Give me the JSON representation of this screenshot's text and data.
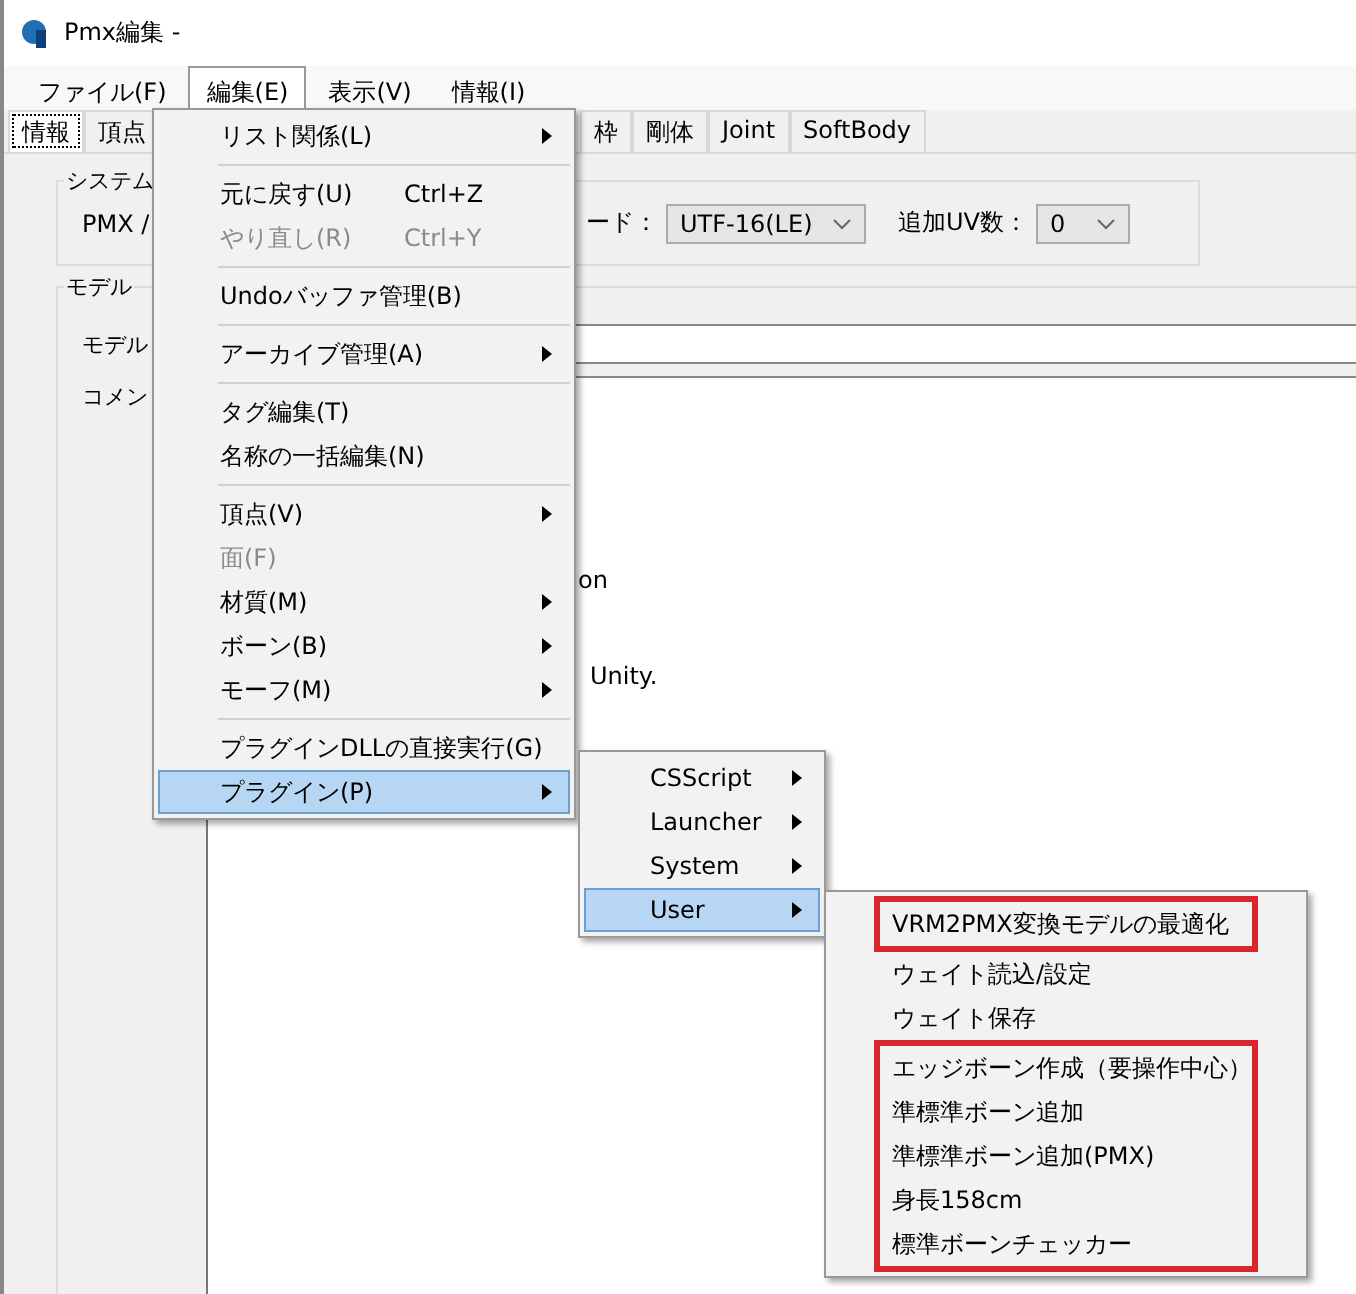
{
  "window": {
    "title": "Pmx編集 -"
  },
  "menubar": [
    {
      "label": "ファイル(F)",
      "selected": false
    },
    {
      "label": "編集(E)",
      "selected": true
    },
    {
      "label": "表示(V)",
      "selected": false
    },
    {
      "label": "情報(I)",
      "selected": false
    }
  ],
  "tabs_left": [
    {
      "label": "情報",
      "selected": true
    },
    {
      "label": "頂点",
      "selected": false
    }
  ],
  "tabs_right": [
    {
      "label": "枠",
      "selected": false
    },
    {
      "label": "剛体",
      "selected": false
    },
    {
      "label": "Joint",
      "selected": false
    },
    {
      "label": "SoftBody",
      "selected": false
    }
  ],
  "system_group": {
    "legend": "システム",
    "pmx_label": "PMX /",
    "encoding_label": "ード：",
    "encoding_value": "UTF-16(LE)",
    "uv_label": "追加UV数：",
    "uv_value": "0"
  },
  "model_group": {
    "legend": "モデル",
    "name_label": "モデル",
    "comment_label": "コメン",
    "comment_fragments": [
      "on",
      "Unity."
    ]
  },
  "edit_menu": [
    {
      "kind": "item",
      "label": "リスト関係(L)",
      "submenu": true,
      "disabled": false,
      "selected": false
    },
    {
      "kind": "separator"
    },
    {
      "kind": "item",
      "label": "元に戻す(U)",
      "shortcut": "Ctrl+Z",
      "submenu": false,
      "disabled": false,
      "selected": false
    },
    {
      "kind": "item",
      "label": "やり直し(R)",
      "shortcut": "Ctrl+Y",
      "submenu": false,
      "disabled": true,
      "selected": false
    },
    {
      "kind": "separator"
    },
    {
      "kind": "item",
      "label": "Undoバッファ管理(B)",
      "submenu": false,
      "disabled": false,
      "selected": false
    },
    {
      "kind": "separator"
    },
    {
      "kind": "item",
      "label": "アーカイブ管理(A)",
      "submenu": true,
      "disabled": false,
      "selected": false
    },
    {
      "kind": "separator"
    },
    {
      "kind": "item",
      "label": "タグ編集(T)",
      "submenu": false,
      "disabled": false,
      "selected": false
    },
    {
      "kind": "item",
      "label": "名称の一括編集(N)",
      "submenu": false,
      "disabled": false,
      "selected": false
    },
    {
      "kind": "separator"
    },
    {
      "kind": "item",
      "label": "頂点(V)",
      "submenu": true,
      "disabled": false,
      "selected": false
    },
    {
      "kind": "item",
      "label": "面(F)",
      "submenu": false,
      "disabled": true,
      "selected": false
    },
    {
      "kind": "item",
      "label": "材質(M)",
      "submenu": true,
      "disabled": false,
      "selected": false
    },
    {
      "kind": "item",
      "label": "ボーン(B)",
      "submenu": true,
      "disabled": false,
      "selected": false
    },
    {
      "kind": "item",
      "label": "モーフ(M)",
      "submenu": true,
      "disabled": false,
      "selected": false
    },
    {
      "kind": "separator"
    },
    {
      "kind": "item",
      "label": "プラグインDLLの直接実行(G)",
      "submenu": false,
      "disabled": false,
      "selected": false
    },
    {
      "kind": "item",
      "label": "プラグイン(P)",
      "submenu": true,
      "disabled": false,
      "selected": true
    }
  ],
  "plugin_menu": [
    {
      "label": "CSScript",
      "selected": false
    },
    {
      "label": "Launcher",
      "selected": false
    },
    {
      "label": "System",
      "selected": false
    },
    {
      "label": "User",
      "selected": true
    }
  ],
  "user_menu": [
    {
      "label": "VRM2PMX変換モデルの最適化",
      "highlighted": true
    },
    {
      "label": "ウェイト読込/設定",
      "highlighted": false
    },
    {
      "label": "ウェイト保存",
      "highlighted": false
    },
    {
      "label": "エッジボーン作成（要操作中心）",
      "highlighted": true
    },
    {
      "label": "準標準ボーン追加",
      "highlighted": true
    },
    {
      "label": "準標準ボーン追加(PMX)",
      "highlighted": true
    },
    {
      "label": "身長158cm",
      "highlighted": true
    },
    {
      "label": "標準ボーンチェッカー",
      "highlighted": true
    }
  ]
}
